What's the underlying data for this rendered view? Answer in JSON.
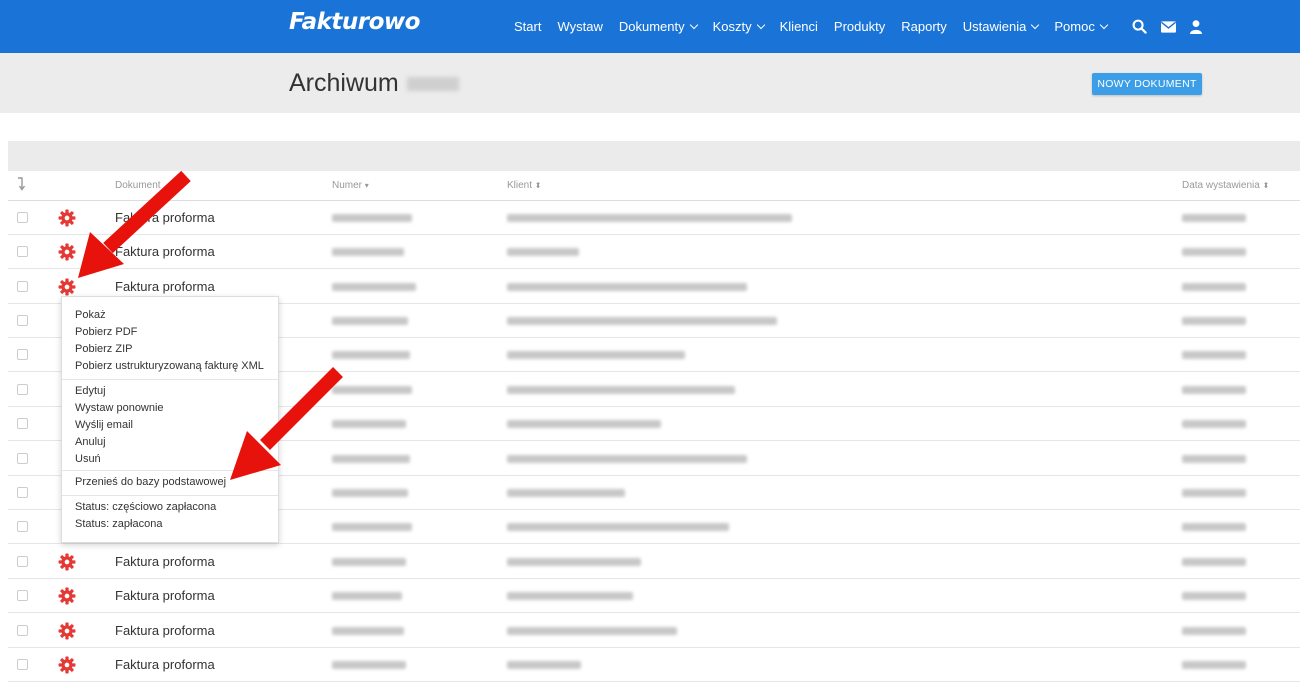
{
  "app": {
    "logo": "Fakturowo"
  },
  "nav": {
    "items": [
      {
        "label": "Start",
        "dropdown": false
      },
      {
        "label": "Wystaw",
        "dropdown": false
      },
      {
        "label": "Dokumenty",
        "dropdown": true
      },
      {
        "label": "Koszty",
        "dropdown": true
      },
      {
        "label": "Klienci",
        "dropdown": false
      },
      {
        "label": "Produkty",
        "dropdown": false
      },
      {
        "label": "Raporty",
        "dropdown": false
      },
      {
        "label": "Ustawienia",
        "dropdown": true
      },
      {
        "label": "Pomoc",
        "dropdown": true
      }
    ],
    "icons": [
      "search-icon",
      "envelope-icon",
      "user-icon"
    ]
  },
  "page": {
    "title": "Archiwum",
    "new_button": "NOWY DOKUMENT"
  },
  "table": {
    "headers": {
      "document": "Dokument",
      "number": "Numer",
      "client": "Klient",
      "date": "Data wystawienia"
    },
    "rows": [
      {
        "type": "Faktura proforma"
      },
      {
        "type": "Faktura proforma"
      },
      {
        "type": "Faktura proforma"
      },
      {
        "type": ""
      },
      {
        "type": ""
      },
      {
        "type": ""
      },
      {
        "type": ""
      },
      {
        "type": ""
      },
      {
        "type": ""
      },
      {
        "type": ""
      },
      {
        "type": "Faktura proforma"
      },
      {
        "type": "Faktura proforma"
      },
      {
        "type": "Faktura proforma"
      },
      {
        "type": "Faktura proforma"
      }
    ]
  },
  "context_menu": {
    "items": [
      "Pokaż",
      "Pobierz PDF",
      "Pobierz ZIP",
      "Pobierz ustrukturyzowaną fakturę XML",
      "Edytuj",
      "Wystaw ponownie",
      "Wyślij email",
      "Anuluj",
      "Usuń",
      "Przenieś do bazy podstawowej",
      "Status: częściowo zapłacona",
      "Status: zapłacona"
    ]
  },
  "colors": {
    "topbar": "#1a73d6",
    "accent_button": "#3d9ee8",
    "gear": "#e53935",
    "arrow": "#e8120c"
  }
}
